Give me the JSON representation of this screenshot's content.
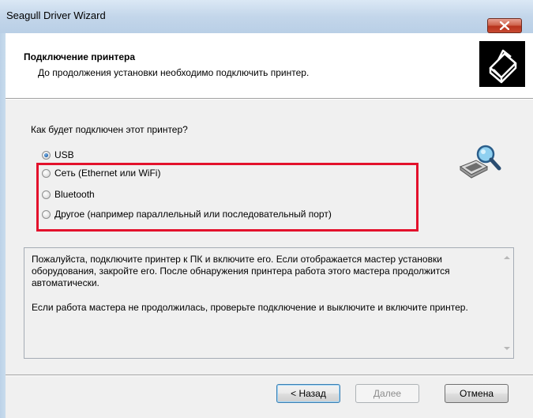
{
  "window": {
    "title": "Seagull Driver Wizard"
  },
  "header": {
    "title": "Подключение принтера",
    "subtitle": "До продолжения установки необходимо подключить принтер."
  },
  "question": "Как будет подключен этот принтер?",
  "options": [
    {
      "label": "USB",
      "checked": true
    },
    {
      "label": "Сеть (Ethernet или WiFi)",
      "checked": false
    },
    {
      "label": "Bluetooth",
      "checked": false
    },
    {
      "label": "Другое (например параллельный или последовательный порт)",
      "checked": false
    }
  ],
  "info": {
    "paragraph1": "Пожалуйста, подключите принтер к ПК и включите его. Если отображается мастер установки оборудования, закройте его. После обнаружения принтера работа этого мастера продолжится автоматически.",
    "paragraph2": "Если работа мастера не продолжилась, проверьте подключение и выключите и включите принтер."
  },
  "buttons": {
    "back": "< Назад",
    "next": "Далее",
    "cancel": "Отмена"
  },
  "colors": {
    "highlight": "#e3112c",
    "titlebar": "#c3d6ea",
    "close": "#c74a32"
  },
  "icons": {
    "close": "close-x-icon",
    "header": "printer-icon",
    "search": "printer-search-icon"
  }
}
